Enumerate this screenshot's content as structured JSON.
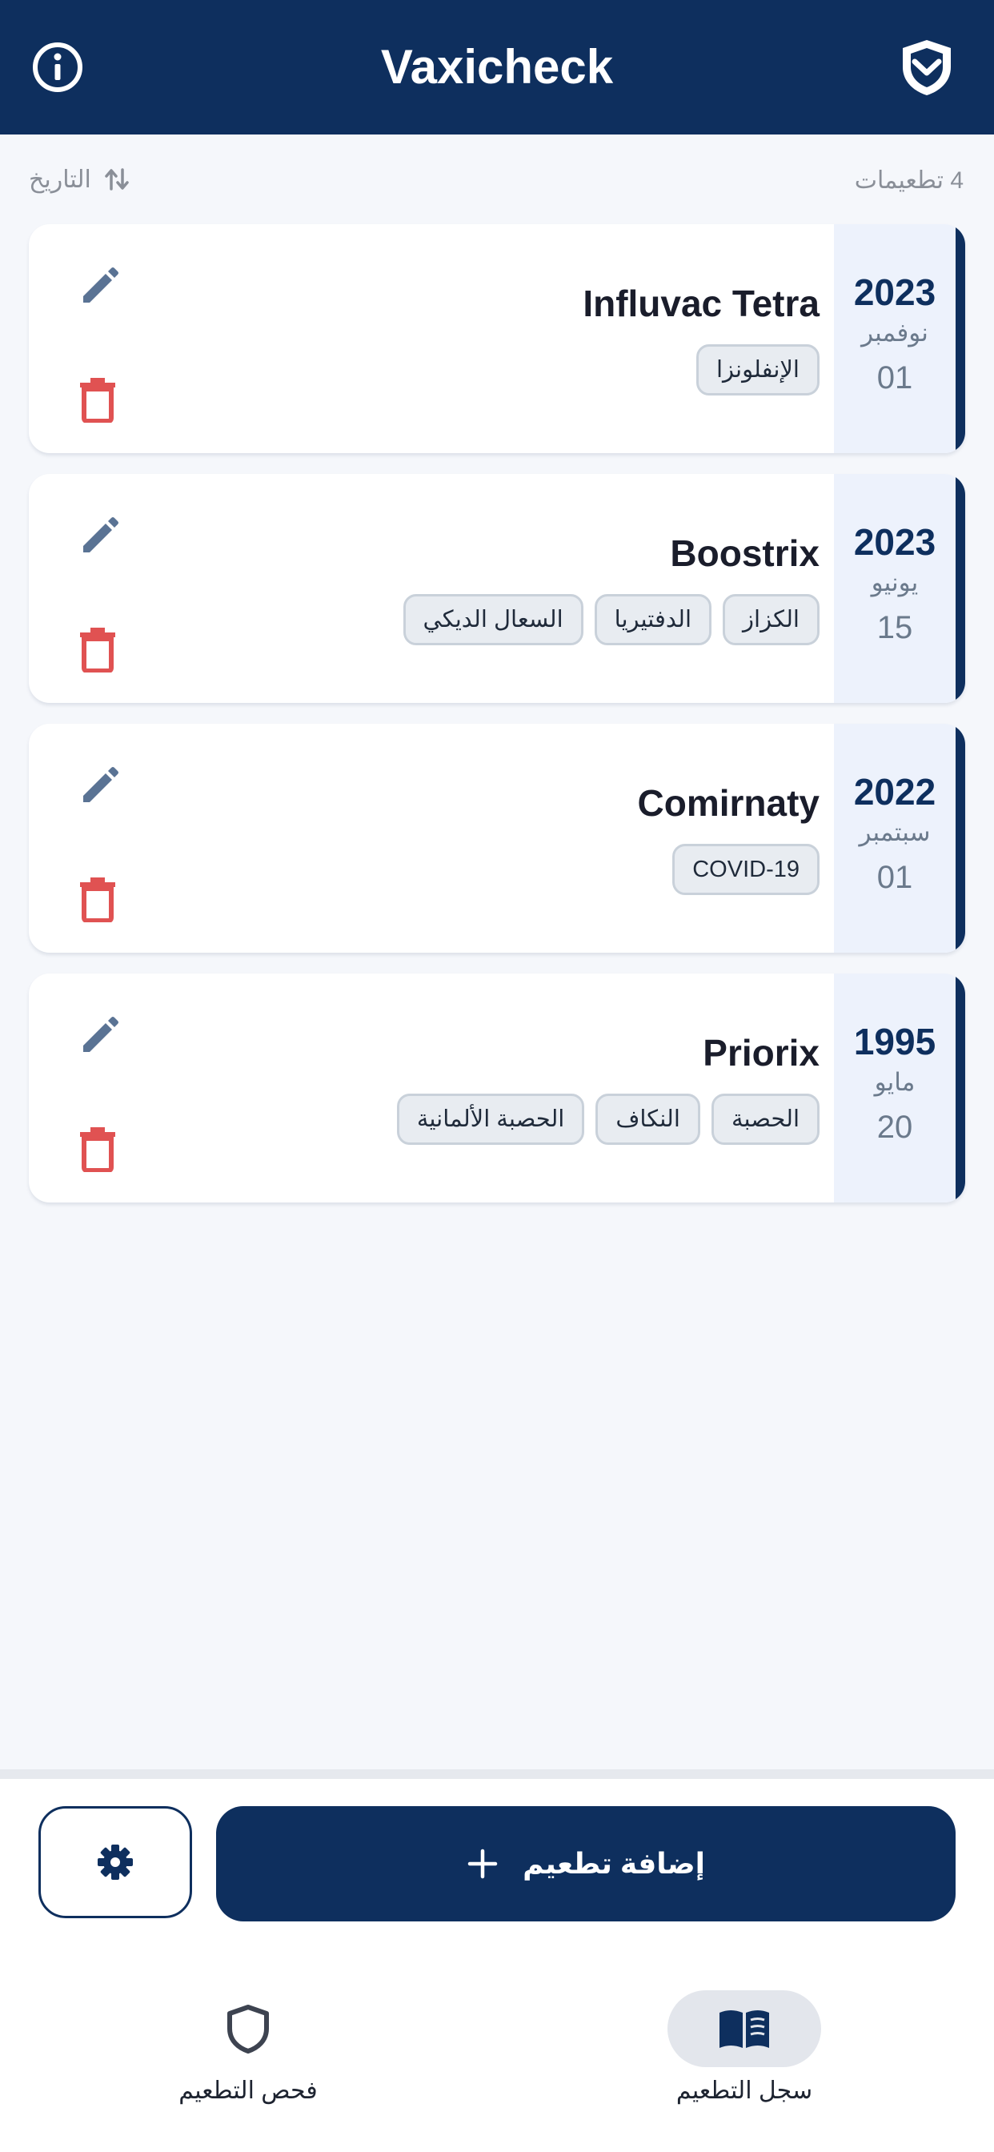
{
  "header": {
    "title": "Vaxicheck",
    "info_icon": "info-icon",
    "shield_icon": "shield-check-icon"
  },
  "toolbar": {
    "count_label": "4 تطعيمات",
    "sort_label": "التاريخ",
    "sort_icon": "sort-arrows-icon"
  },
  "vaccinations": [
    {
      "name": "Influvac Tetra",
      "year": "2023",
      "month": "نوفمبر",
      "day": "01",
      "tags": [
        "الإنفلونزا"
      ]
    },
    {
      "name": "Boostrix",
      "year": "2023",
      "month": "يونيو",
      "day": "15",
      "tags": [
        "الكزاز",
        "الدفتيريا",
        "السعال الديكي"
      ]
    },
    {
      "name": "Comirnaty",
      "year": "2022",
      "month": "سبتمبر",
      "day": "01",
      "tags": [
        "COVID-19"
      ]
    },
    {
      "name": "Priorix",
      "year": "1995",
      "month": "مايو",
      "day": "20",
      "tags": [
        "الحصبة",
        "النكاف",
        "الحصبة الألمانية"
      ]
    }
  ],
  "actions": {
    "add_label": "إضافة تطعيم",
    "add_icon": "plus-icon",
    "settings_icon": "gear-icon"
  },
  "nav": {
    "check_label": "فحص التطعيم",
    "log_label": "سجل التطعيم",
    "active": "log"
  },
  "colors": {
    "primary": "#0e2f5e",
    "danger": "#e05252",
    "edit": "#5a7394",
    "date_bg": "#edf2fc"
  }
}
